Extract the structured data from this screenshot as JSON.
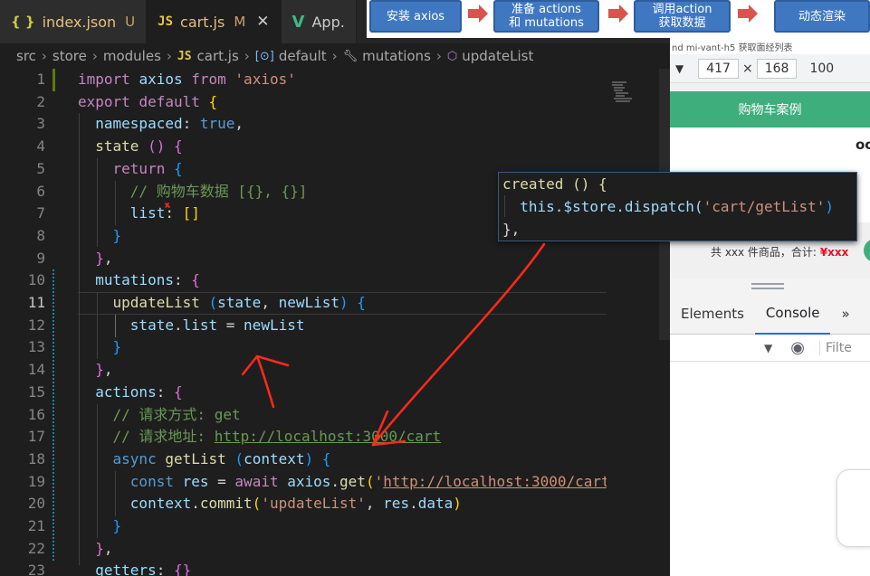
{
  "tabs": [
    {
      "icon": "{ }",
      "name": "index.json",
      "status": "U"
    },
    {
      "icon": "JS",
      "name": "cart.js",
      "status": "M",
      "close": "✕"
    },
    {
      "icon": "V",
      "name": "App."
    }
  ],
  "breadcrumb": {
    "items": [
      "src",
      "store",
      "modules",
      "cart.js",
      "default",
      "mutations",
      "updateList"
    ],
    "file_icon": "JS"
  },
  "code": {
    "current_line": 11,
    "line_numbers": [
      "1",
      "2",
      "3",
      "4",
      "5",
      "6",
      "7",
      "8",
      "9",
      "10",
      "11",
      "12",
      "13",
      "14",
      "15",
      "16",
      "17",
      "18",
      "19",
      "20",
      "21",
      "22",
      "23"
    ]
  },
  "flow": {
    "steps": [
      "安装 axios",
      "准备 actions\n和 mutations",
      "调用action\n获取数据",
      "动态渲染"
    ]
  },
  "popup": {
    "line1": "created () {",
    "line2_prefix": "  this.$store.dispatch(",
    "line2_string": "'cart/getList'",
    "line2_suffix": ")",
    "line3": "},"
  },
  "browser": {
    "bookmarks": "nd   mi-vant-h5   获取面经列表",
    "width": "417",
    "times": "×",
    "height": "168",
    "zoom": "100",
    "preview_title": "购物车案例",
    "preview_edge": "oc",
    "total_text": "共 xxx 件商品，合计:",
    "total_price": "¥xxx",
    "devtools_tabs": [
      "Elements",
      "Console",
      "»"
    ],
    "filter_placeholder": "Filte"
  },
  "colors": {
    "accent": "#3f78c1",
    "preview_green": "#3eaf7c",
    "annotation_red": "#ff2a1a"
  }
}
